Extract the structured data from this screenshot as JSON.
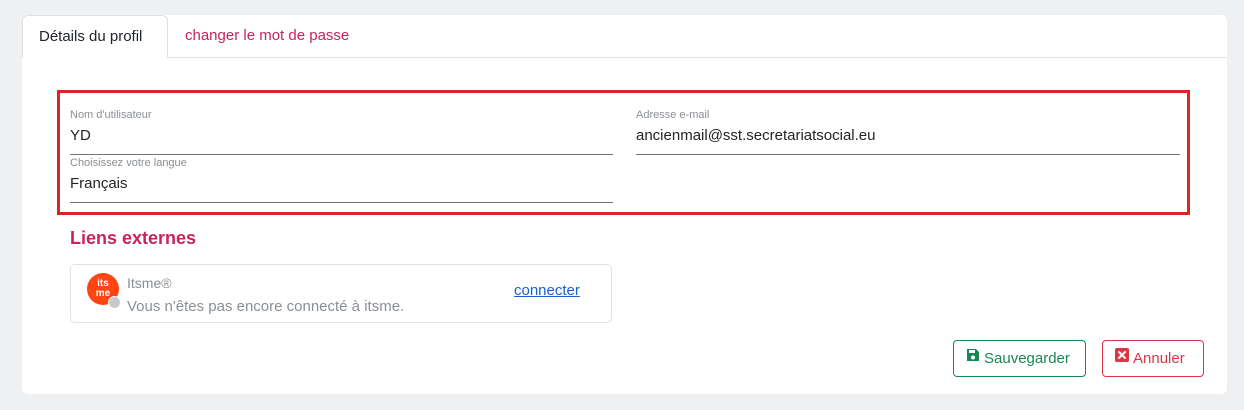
{
  "tabs": [
    {
      "label": "Détails du profil",
      "active": true
    },
    {
      "label": "changer le mot de passe",
      "active": false
    }
  ],
  "form": {
    "username": {
      "label": "Nom d'utilisateur",
      "value": "YD"
    },
    "email": {
      "label": "Adresse e-mail",
      "value": "ancienmail@sst.secretariatsocial.eu"
    },
    "language": {
      "label": "Choisissez votre langue",
      "value": "Français"
    }
  },
  "external_links": {
    "title": "Liens externes",
    "provider": {
      "logo_text_top": "its",
      "logo_text_bottom": "me",
      "name": "Itsme®",
      "status": "Vous n'êtes pas encore connecté à itsme.",
      "action": "connecter",
      "connected": false
    }
  },
  "actions": {
    "save_label": "Sauvegarder",
    "cancel_label": "Annuler"
  },
  "colors": {
    "accent": "#c8245a",
    "highlight_border": "#e02424",
    "save": "#198754",
    "cancel": "#dc3545",
    "link": "#1a5fcf",
    "itsme": "#ff4612"
  },
  "icons": {
    "save": "floppy-disk-icon",
    "cancel": "close-square-icon",
    "provider_logo": "itsme-logo-icon",
    "status": "status-dot-icon"
  }
}
